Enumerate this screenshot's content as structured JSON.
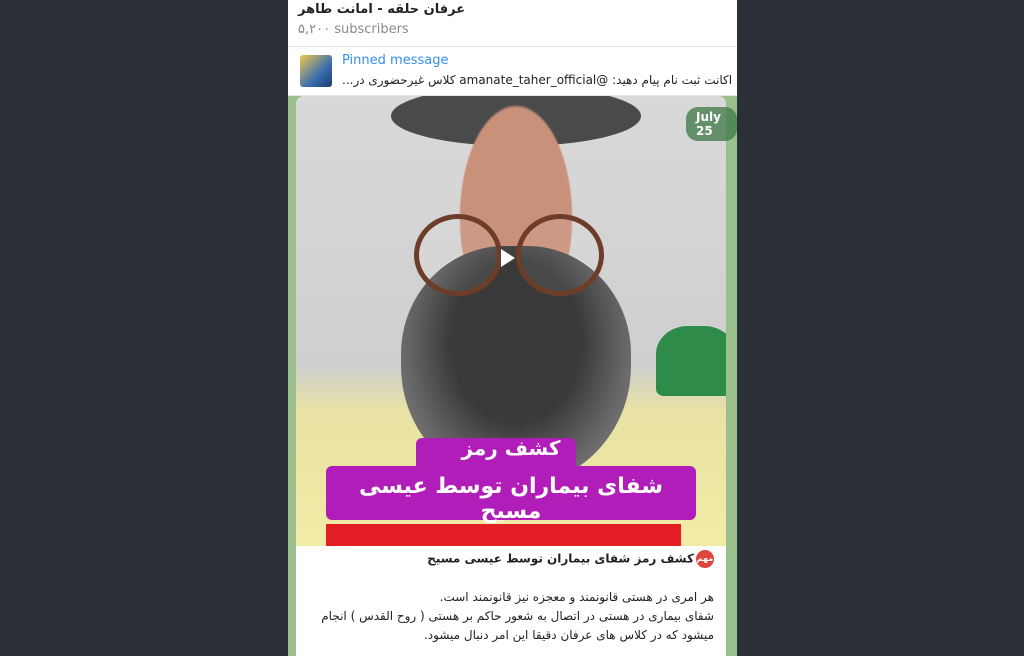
{
  "header": {
    "channel_name": "عرفان حلقه - امانت طاهر",
    "subscribers": "۵,۲۰۰ subscribers"
  },
  "pinned": {
    "label": "Pinned message",
    "text": "اکانت ثبت نام پیام دهید: @amanate_taher_official کلاس غیرحضوری در..."
  },
  "message": {
    "date_badge": "July 25",
    "video_banner_line1": "کشف رمز",
    "video_banner_line2": "شفای بیماران توسط عیسی مسیح",
    "caption_badge": "مهم",
    "caption_title": "کشف رمز شفای بیماران توسط عیسی مسیح",
    "caption_lines": [
      "هر امری در هستی قانونمند و معجزه نیز قانونمند است.",
      "شفای بیماری در هستی در اتصال به شعور حاکم بر هستی ( روح القدس ) انجام",
      "میشود که در کلاس های عرفان دقیقا این امر دنبال میشود."
    ]
  }
}
